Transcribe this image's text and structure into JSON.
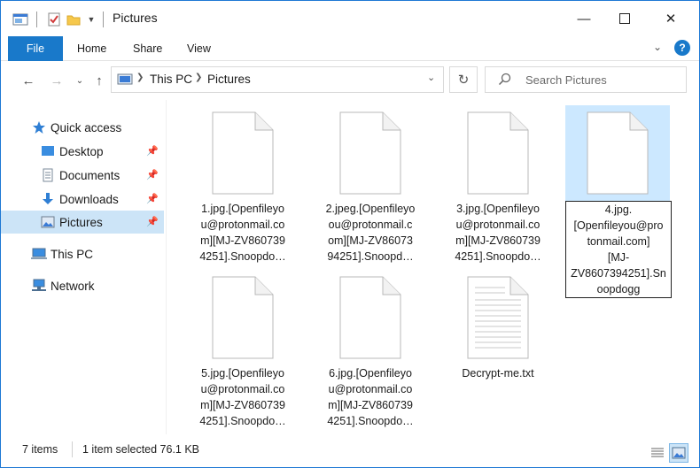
{
  "window": {
    "title": "Pictures",
    "minimize": "—",
    "maximize": "☐",
    "close": "✕"
  },
  "ribbon": {
    "file": "File",
    "tabs": [
      "Home",
      "Share",
      "View"
    ]
  },
  "address": {
    "crumbs": [
      "This PC",
      "Pictures"
    ],
    "search_placeholder": "Search Pictures"
  },
  "nav": {
    "quick_access": "Quick access",
    "items": [
      {
        "label": "Desktop"
      },
      {
        "label": "Documents"
      },
      {
        "label": "Downloads"
      },
      {
        "label": "Pictures"
      }
    ],
    "this_pc": "This PC",
    "network": "Network"
  },
  "files": [
    {
      "name": "1.jpg.[Openfileyou@protonmail.com][MJ-ZV8607394251].Snoopdo…",
      "lines": [
        "1.jpg.[Openfileyo",
        "u@protonmail.co",
        "m][MJ-ZV860739",
        "4251].Snoopdo…"
      ]
    },
    {
      "name": "2.jpeg",
      "lines": [
        "2.jpeg.[Openfileyo",
        "ou@protonmail.c",
        "om][MJ-ZV86073",
        "94251].Snoopd…"
      ]
    },
    {
      "name": "3.jpg",
      "lines": [
        "3.jpg.[Openfileyo",
        "u@protonmail.co",
        "m][MJ-ZV860739",
        "4251].Snoopdo…"
      ]
    },
    {
      "name": "4.jpg",
      "lines": [
        "4.jpg.",
        "[Openfileyou@pro",
        "tonmail.com]",
        "[MJ-",
        "ZV8607394251].Sn",
        "oopdogg"
      ]
    },
    {
      "name": "5.jpg",
      "lines": [
        "5.jpg.[Openfileyo",
        "u@protonmail.co",
        "m][MJ-ZV860739",
        "4251].Snoopdo…"
      ]
    },
    {
      "name": "6.jpg",
      "lines": [
        "6.jpg.[Openfileyo",
        "u@protonmail.co",
        "m][MJ-ZV860739",
        "4251].Snoopdo…"
      ]
    },
    {
      "name": "Decrypt-me.txt",
      "lines": [
        "Decrypt-me.txt"
      ]
    }
  ],
  "status": {
    "count": "7 items",
    "selection": "1 item selected  76.1 KB"
  },
  "colors": {
    "accent": "#1979ca",
    "selection": "#cce8ff"
  }
}
